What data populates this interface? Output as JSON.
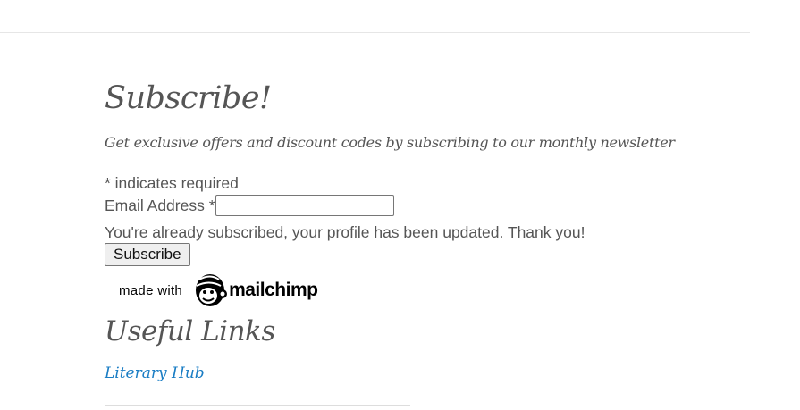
{
  "subscribe": {
    "title": "Subscribe!",
    "tagline": "Get exclusive offers and discount codes by subscribing to our monthly newsletter"
  },
  "form": {
    "required_note": "* indicates required",
    "email_label": "Email Address *",
    "email_value": "",
    "status_message": "You're already subscribed, your profile has been updated. Thank you!",
    "submit_label": "Subscribe"
  },
  "badge": {
    "made_with": "made with",
    "brand": "mailchimp",
    "logo_icon": "mailchimp-freddie-icon"
  },
  "useful_links": {
    "title": "Useful Links",
    "links": [
      {
        "label": "Literary Hub"
      }
    ]
  },
  "colors": {
    "text": "#555555",
    "link": "#1a7dc4"
  }
}
